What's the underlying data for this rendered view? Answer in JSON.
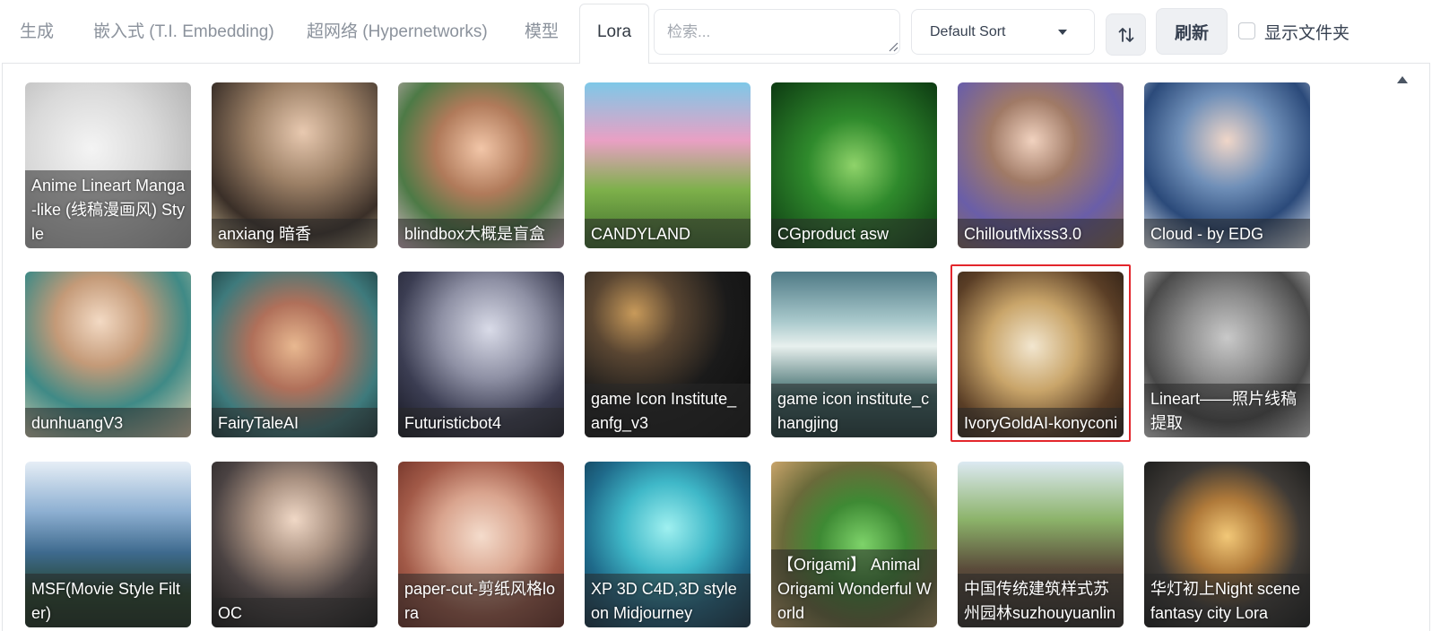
{
  "tabs": [
    {
      "label": "生成"
    },
    {
      "label": "嵌入式 (T.I. Embedding)"
    },
    {
      "label": "超网络 (Hypernetworks)"
    },
    {
      "label": "模型"
    },
    {
      "label": "Lora"
    }
  ],
  "search": {
    "placeholder": "检索...",
    "value": ""
  },
  "sort": {
    "selected": "Default Sort",
    "icon": "chevron-down-icon"
  },
  "order_toggle": {
    "icon": "sort-arrows-icon"
  },
  "refresh": {
    "label": "刷新"
  },
  "show_folders": {
    "label": "显示文件夹",
    "checked": false
  },
  "colors": {
    "selected_outline": "#e3262c",
    "button_bg": "#eef0f3"
  },
  "cards": [
    {
      "name": "Anime Lineart Manga-like (线稿漫画风) Style"
    },
    {
      "name": "anxiang 暗香"
    },
    {
      "name": "blindbox大概是盲盒"
    },
    {
      "name": "CANDYLAND"
    },
    {
      "name": "CGproduct asw"
    },
    {
      "name": "ChilloutMixss3.0"
    },
    {
      "name": "Cloud - by EDG"
    },
    {
      "name": "dunhuangV3"
    },
    {
      "name": "FairyTaleAI"
    },
    {
      "name": "Futuristicbot4"
    },
    {
      "name": "game Icon Institute_anfg_v3"
    },
    {
      "name": "game icon institute_changjing"
    },
    {
      "name": "IvoryGoldAI-konyconi",
      "selected": true
    },
    {
      "name": "Lineart——照片线稿提取"
    },
    {
      "name": "MSF(Movie Style Filter)"
    },
    {
      "name": "OC"
    },
    {
      "name": "paper-cut-剪纸风格lora"
    },
    {
      "name": "XP 3D C4D,3D style on Midjourney"
    },
    {
      "name": "【Origami】 Animal Origami Wonderful World"
    },
    {
      "name": "中国传统建筑样式苏州园林suzhouyuanlin"
    },
    {
      "name": "华灯初上Night scenefantasy city Lora"
    }
  ]
}
